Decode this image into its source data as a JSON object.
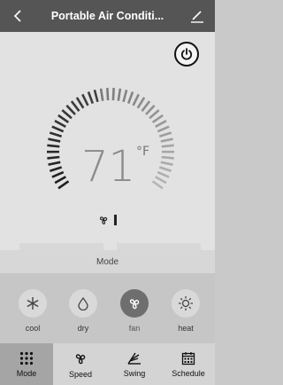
{
  "header": {
    "title": "Portable Air Conditi...",
    "back_icon": "chevron-left-icon",
    "edit_icon": "pencil-icon"
  },
  "thermostat": {
    "temperature": "71",
    "unit": "°F",
    "fan_speed_level": 1,
    "power_icon": "power-icon"
  },
  "controls": {
    "decrease": "−",
    "increase": "+"
  },
  "mode_panel": {
    "title": "Mode",
    "selected": "fan",
    "options": [
      {
        "label": "cool",
        "icon": "snowflake-icon"
      },
      {
        "label": "dry",
        "icon": "droplet-icon"
      },
      {
        "label": "fan",
        "icon": "fan-icon"
      },
      {
        "label": "heat",
        "icon": "sun-icon"
      }
    ]
  },
  "tabs": [
    {
      "label": "Mode",
      "icon": "grid-icon",
      "active": true
    },
    {
      "label": "Speed",
      "icon": "fan-icon",
      "active": false
    },
    {
      "label": "Swing",
      "icon": "swing-icon",
      "active": false
    },
    {
      "label": "Schedule",
      "icon": "calendar-icon",
      "active": false
    }
  ],
  "colors": {
    "header_bg": "#555555",
    "active_mode": "#6e6e6e",
    "active_tab": "#a5a5a5"
  }
}
